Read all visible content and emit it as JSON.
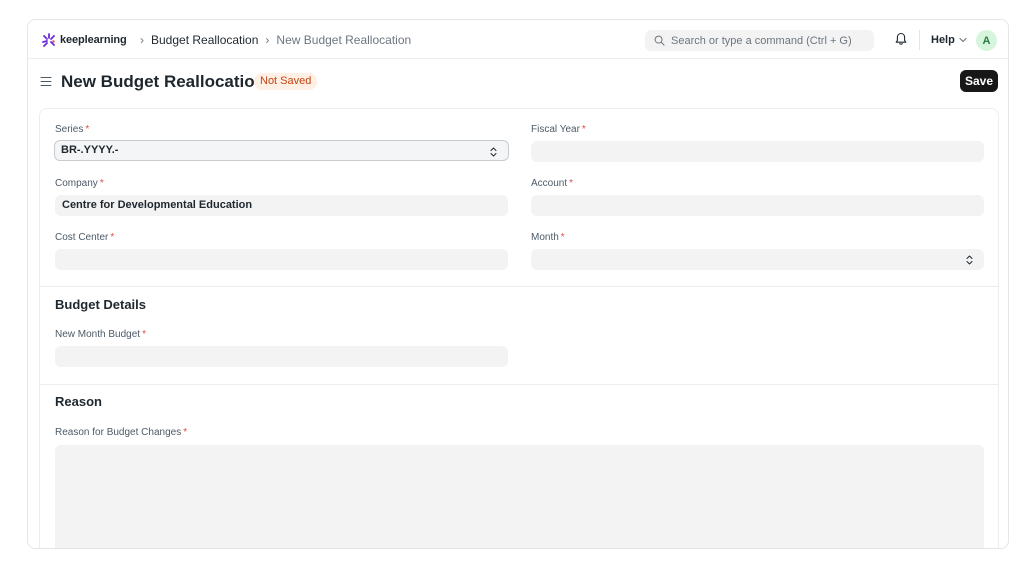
{
  "brand": {
    "name": "keeplearning",
    "color": "#6c2bd9"
  },
  "breadcrumbs": [
    "Budget Reallocation",
    "New Budget Reallocation"
  ],
  "search": {
    "placeholder": "Search or type a command (Ctrl + G)"
  },
  "nav": {
    "help_label": "Help",
    "avatar_initial": "A"
  },
  "page": {
    "title": "New Budget Reallocation",
    "status": "Not Saved",
    "save_label": "Save"
  },
  "fields": {
    "series": {
      "label": "Series",
      "value": "BR-.YYYY.-"
    },
    "fiscal_year": {
      "label": "Fiscal Year",
      "value": ""
    },
    "company": {
      "label": "Company",
      "value": "Centre for Developmental Education"
    },
    "account": {
      "label": "Account",
      "value": ""
    },
    "cost_center": {
      "label": "Cost Center",
      "value": ""
    },
    "month": {
      "label": "Month",
      "value": ""
    },
    "new_month_budget": {
      "label": "New Month Budget",
      "value": ""
    },
    "reason": {
      "label": "Reason for Budget Changes",
      "value": ""
    }
  },
  "sections": {
    "budget_details": "Budget Details",
    "reason": "Reason"
  },
  "required_marker": "*"
}
